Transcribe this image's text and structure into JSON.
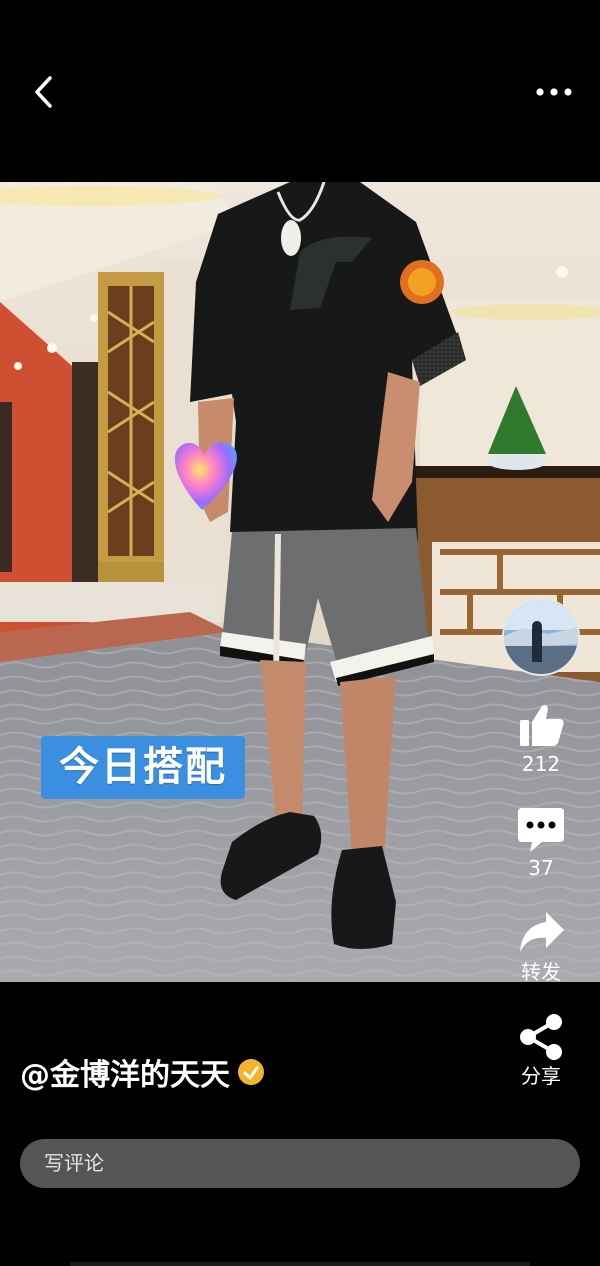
{
  "post": {
    "sticker_text": "今日搭配"
  },
  "actions": {
    "like_count": "212",
    "comment_count": "37",
    "repost_label": "转发",
    "share_label": "分享"
  },
  "author": {
    "handle": "@金博洋的天天"
  },
  "comment": {
    "placeholder": "写评论"
  },
  "colors": {
    "background": "#000000",
    "sticker_blue": "#3a8fe0",
    "verified_badge": "#f3b52b",
    "comment_box": "#555555"
  },
  "icons": [
    "back-icon",
    "more-icon",
    "like-icon",
    "comment-icon",
    "repost-icon",
    "share-icon",
    "verified-icon",
    "heart-sticker-icon"
  ]
}
